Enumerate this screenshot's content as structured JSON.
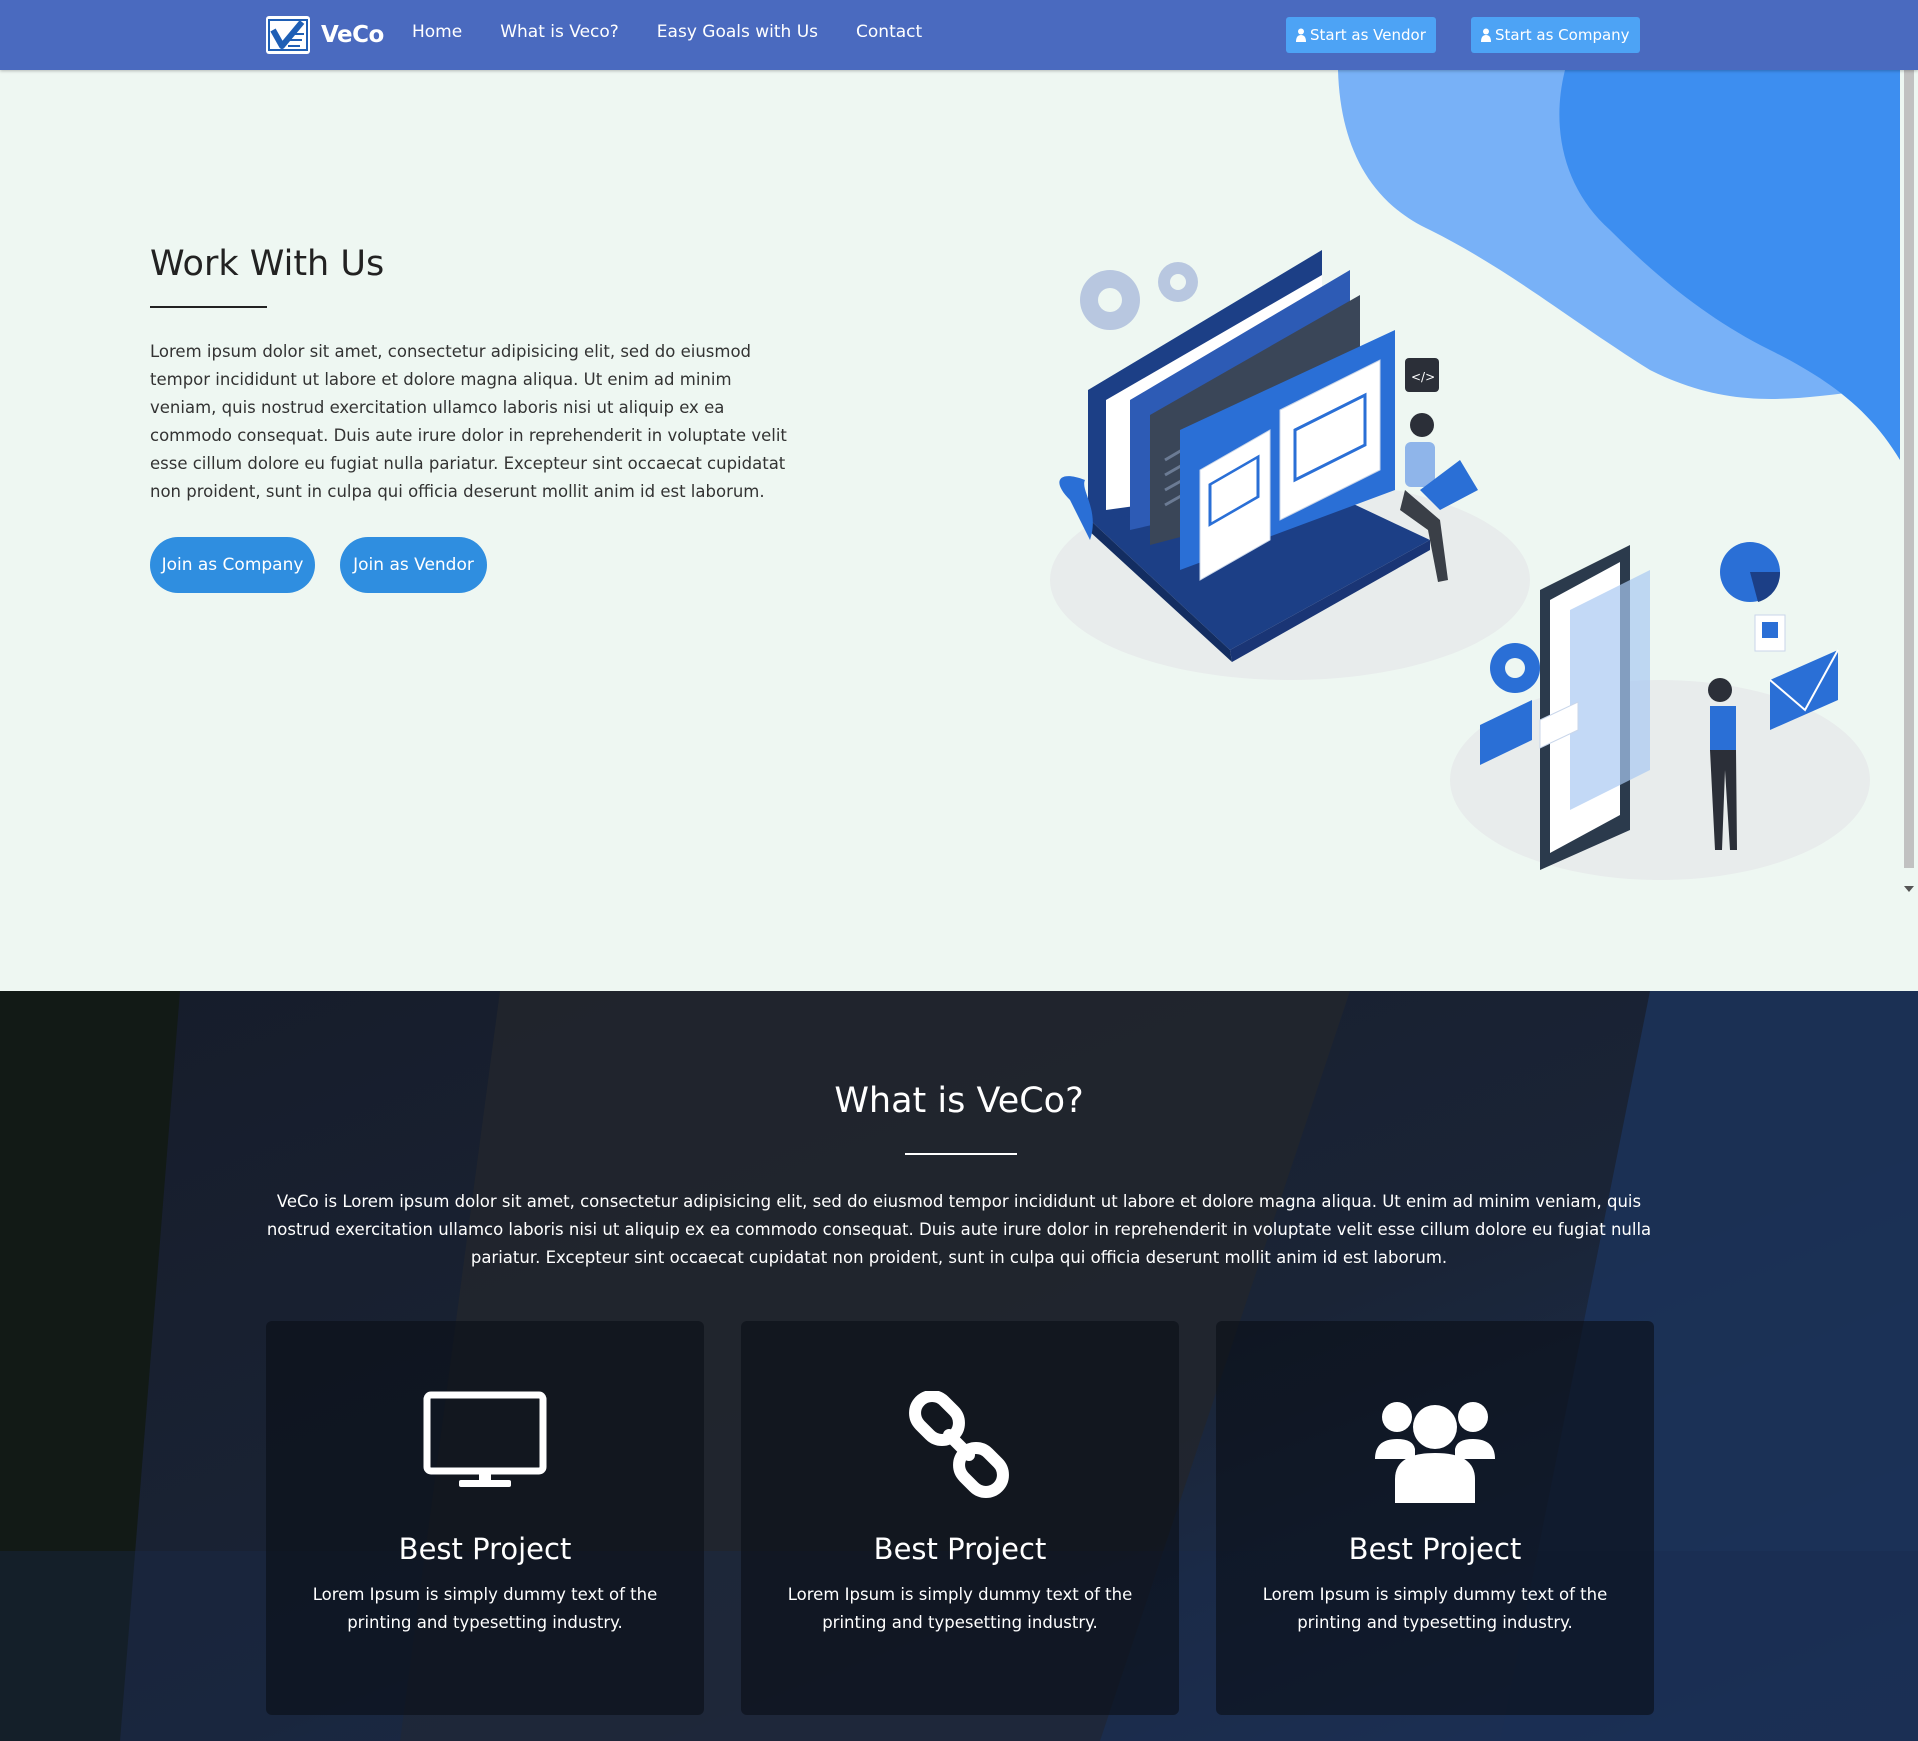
{
  "navbar": {
    "brand": "VeCo",
    "links": [
      "Home",
      "What is Veco?",
      "Easy Goals with Us",
      "Contact"
    ],
    "vendor_button": "Start as Vendor",
    "company_button": "Start as Company",
    "icon": "user-icon",
    "background": "#4a6abf",
    "button_color": "#4da3f5"
  },
  "hero": {
    "title": "Work With Us",
    "text": "Lorem ipsum dolor sit amet, consectetur adipisicing elit, sed do eiusmod tempor incididunt ut labore et dolore magna aliqua. Ut enim ad minim veniam, quis nostrud exercitation ullamco laboris nisi ut aliquip ex ea commodo consequat. Duis aute irure dolor in reprehenderit in voluptate velit esse cillum dolore eu fugiat nulla pariatur. Excepteur sint occaecat cupidatat non proident, sunt in culpa qui officia deserunt mollit anim id est laborum.",
    "join_company": "Join as Company",
    "join_vendor": "Join as Vendor",
    "button_color": "#2f8ee0"
  },
  "about": {
    "title": "What is VeCo?",
    "text": "VeCo is Lorem ipsum dolor sit amet, consectetur adipisicing elit, sed do eiusmod tempor incididunt ut labore et dolore magna aliqua. Ut enim ad minim veniam, quis nostrud exercitation ullamco laboris nisi ut aliquip ex ea commodo consequat. Duis aute irure dolor in reprehenderit in voluptate velit esse cillum dolore eu fugiat nulla pariatur. Excepteur sint occaecat cupidatat non proident, sunt in culpa qui officia deserunt mollit anim id est laborum.",
    "cards": [
      {
        "icon": "desktop-icon",
        "title": "Best Project",
        "text": "Lorem Ipsum is simply dummy text of the printing and typesetting industry."
      },
      {
        "icon": "link-icon",
        "title": "Best Project",
        "text": "Lorem Ipsum is simply dummy text of the printing and typesetting industry."
      },
      {
        "icon": "users-icon",
        "title": "Best Project",
        "text": "Lorem Ipsum is simply dummy text of the printing and typesetting industry."
      }
    ]
  }
}
